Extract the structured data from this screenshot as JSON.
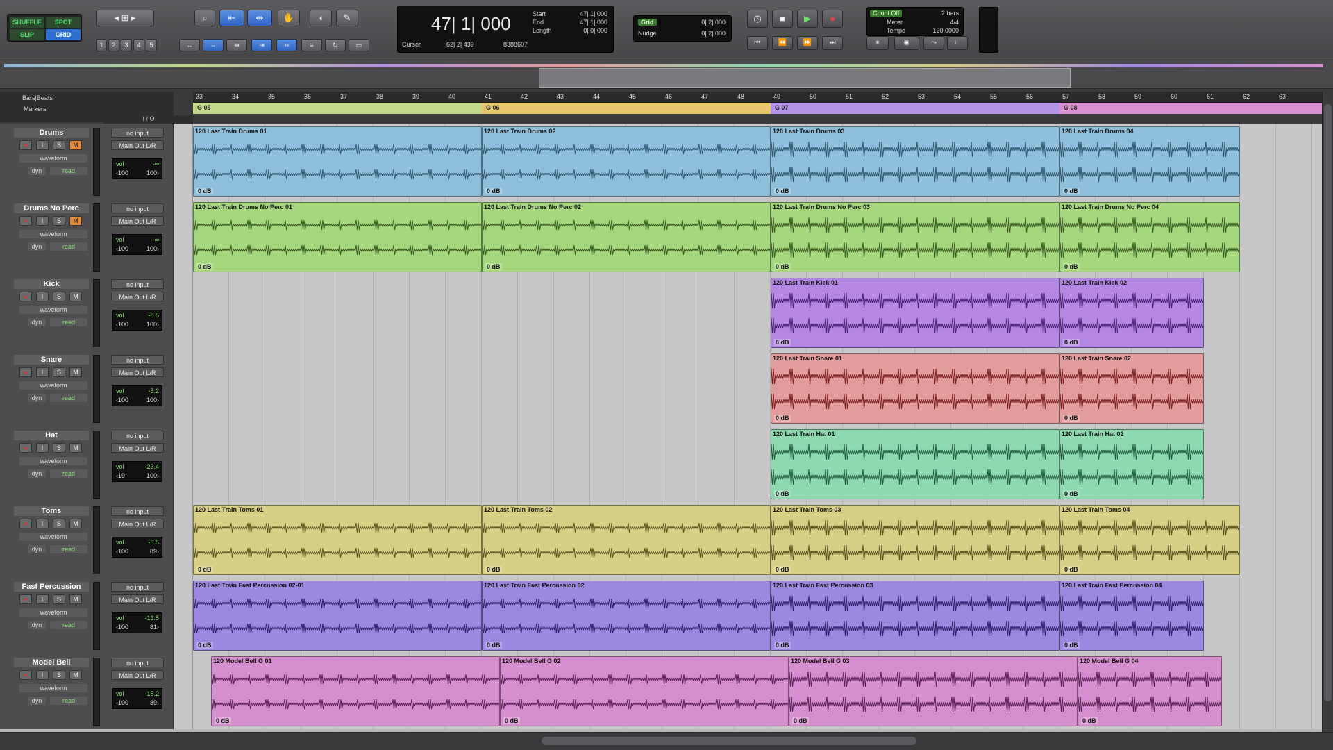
{
  "edit_modes": {
    "shuffle": "SHUFFLE",
    "spot": "SPOT",
    "slip": "SLIP",
    "grid": "GRID"
  },
  "counter": {
    "main": "47| 1| 000",
    "start_label": "Start",
    "start_value": "47| 1| 000",
    "end_label": "End",
    "end_value": "47| 1| 000",
    "length_label": "Length",
    "length_value": "0| 0| 000",
    "cursor_label": "Cursor",
    "cursor_value": "62| 2| 439",
    "cursor_sample": "8388607"
  },
  "grid_nudge": {
    "grid_label": "Grid",
    "grid_value": "0| 2| 000",
    "nudge_label": "Nudge",
    "nudge_value": "0| 2| 000"
  },
  "meter_tempo": {
    "count_off": "Count Off",
    "count_off_value": "2 bars",
    "meter_label": "Meter",
    "meter_value": "4/4",
    "tempo_label": "Tempo",
    "tempo_value": "120.0000"
  },
  "ruler": {
    "bars_label": "Bars|Beats",
    "markers_label": "Markers",
    "io_label": "I / O",
    "bar_numbers": [
      "33",
      "34",
      "35",
      "36",
      "37",
      "38",
      "39",
      "40",
      "41",
      "42",
      "43",
      "44",
      "45",
      "46",
      "47",
      "48",
      "49",
      "50",
      "51",
      "52",
      "53",
      "54",
      "55",
      "56",
      "57",
      "58",
      "59",
      "60",
      "61",
      "62",
      "63"
    ],
    "markers": [
      {
        "label": "G 05",
        "color": "#c4d98a"
      },
      {
        "label": "G 06",
        "color": "#e8c770"
      },
      {
        "label": "G 07",
        "color": "#b593e8"
      },
      {
        "label": "G 08",
        "color": "#d98fd0"
      }
    ]
  },
  "tracks": [
    {
      "name": "Drums",
      "mute_on": true,
      "input": "no input",
      "output": "Main Out L/R",
      "view": "waveform",
      "dyn": "dyn",
      "automation": "read",
      "vol_label": "vol",
      "vol": "-∞",
      "pan_l": "‹100",
      "pan_r": "100›",
      "color": "#8fbfdc",
      "wave": "#2f5870",
      "clips": [
        "120 Last Train Drums 01",
        "120 Last Train Drums 02",
        "120 Last Train Drums 03",
        "120 Last Train Drums 04"
      ],
      "gain": "0 dB"
    },
    {
      "name": "Drums No Perc",
      "mute_on": true,
      "input": "no input",
      "output": "Main Out L/R",
      "view": "waveform",
      "dyn": "dyn",
      "automation": "read",
      "vol_label": "vol",
      "vol": "-∞",
      "pan_l": "‹100",
      "pan_r": "100›",
      "color": "#a5d77f",
      "wave": "#3a5a22",
      "clips": [
        "120 Last Train Drums No Perc 01",
        "120 Last Train Drums No Perc 02",
        "120 Last Train Drums No Perc 03",
        "120 Last Train Drums No Perc 04"
      ],
      "gain": "0 dB"
    },
    {
      "name": "Kick",
      "mute_on": false,
      "input": "no input",
      "output": "Main Out L/R",
      "view": "waveform",
      "dyn": "dyn",
      "automation": "read",
      "vol_label": "vol",
      "vol": "-8.5",
      "pan_l": "‹100",
      "pan_r": "100›",
      "color": "#b487e2",
      "wave": "#4a2478",
      "clips": [
        "120 Last Train Kick 01",
        "120 Last Train Kick 02"
      ],
      "gain": "0 dB"
    },
    {
      "name": "Snare",
      "mute_on": false,
      "input": "no input",
      "output": "Main Out L/R",
      "view": "waveform",
      "dyn": "dyn",
      "automation": "read",
      "vol_label": "vol",
      "vol": "-5.2",
      "pan_l": "‹100",
      "pan_r": "100›",
      "color": "#e29c9c",
      "wave": "#7a1e1e",
      "clips": [
        "120 Last Train Snare 01",
        "120 Last Train Snare 02"
      ],
      "gain": "0 dB"
    },
    {
      "name": "Hat",
      "mute_on": false,
      "input": "no input",
      "output": "Main Out L/R",
      "view": "waveform",
      "dyn": "dyn",
      "automation": "read",
      "vol_label": "vol",
      "vol": "-23.4",
      "pan_l": "‹19",
      "pan_r": "100›",
      "color": "#8fd9b0",
      "wave": "#1f5a3a",
      "clips": [
        "120 Last Train Hat 01",
        "120 Last Train Hat 02"
      ],
      "gain": "0 dB"
    },
    {
      "name": "Toms",
      "mute_on": false,
      "input": "no input",
      "output": "Main Out L/R",
      "view": "waveform",
      "dyn": "dyn",
      "automation": "read",
      "vol_label": "vol",
      "vol": "-5.5",
      "pan_l": "‹100",
      "pan_r": "89›",
      "color": "#d8cf86",
      "wave": "#5a5320",
      "clips": [
        "120 Last Train Toms 01",
        "120 Last Train Toms 02",
        "120 Last Train Toms 03",
        "120 Last Train Toms 04"
      ],
      "gain": "0 dB"
    },
    {
      "name": "Fast Percussion",
      "mute_on": false,
      "input": "no input",
      "output": "Main Out L/R",
      "view": "waveform",
      "dyn": "dyn",
      "automation": "read",
      "vol_label": "vol",
      "vol": "-13.5",
      "pan_l": "‹100",
      "pan_r": "81›",
      "color": "#9c88e0",
      "wave": "#2e1f6a",
      "clips": [
        "120 Last Train Fast Percussion 02-01",
        "120 Last Train Fast Percussion 02",
        "120 Last Train Fast Percussion 03",
        "120 Last Train Fast Percussion 04"
      ],
      "gain": "0 dB"
    },
    {
      "name": "Model Bell",
      "mute_on": false,
      "input": "no input",
      "output": "Main Out L/R",
      "view": "waveform",
      "dyn": "dyn",
      "automation": "read",
      "vol_label": "vol",
      "vol": "-15.2",
      "pan_l": "‹100",
      "pan_r": "89›",
      "color": "#d58fd0",
      "wave": "#5a1f55",
      "clips": [
        "120 Model Bell G 01",
        "120 Model Bell G 02",
        "120 Model Bell G 03",
        "120 Model Bell G 04"
      ],
      "gain": "0 dB"
    }
  ]
}
